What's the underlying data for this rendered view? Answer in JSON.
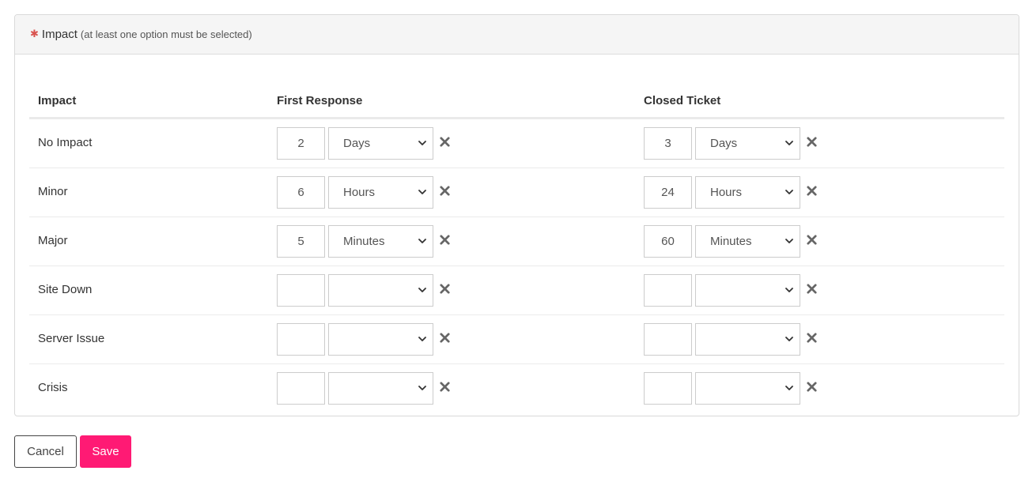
{
  "panel": {
    "required_marker": "✱",
    "title": "Impact",
    "hint": "(at least one option must be selected)"
  },
  "table": {
    "headers": {
      "impact": "Impact",
      "first_response": "First Response",
      "closed_ticket": "Closed Ticket"
    },
    "rows": [
      {
        "label": "No Impact",
        "first_response": {
          "value": "2",
          "unit": "Days"
        },
        "closed_ticket": {
          "value": "3",
          "unit": "Days"
        }
      },
      {
        "label": "Minor",
        "first_response": {
          "value": "6",
          "unit": "Hours"
        },
        "closed_ticket": {
          "value": "24",
          "unit": "Hours"
        }
      },
      {
        "label": "Major",
        "first_response": {
          "value": "5",
          "unit": "Minutes"
        },
        "closed_ticket": {
          "value": "60",
          "unit": "Minutes"
        }
      },
      {
        "label": "Site Down",
        "first_response": {
          "value": "",
          "unit": ""
        },
        "closed_ticket": {
          "value": "",
          "unit": ""
        }
      },
      {
        "label": "Server Issue",
        "first_response": {
          "value": "",
          "unit": ""
        },
        "closed_ticket": {
          "value": "",
          "unit": ""
        }
      },
      {
        "label": "Crisis",
        "first_response": {
          "value": "",
          "unit": ""
        },
        "closed_ticket": {
          "value": "",
          "unit": ""
        }
      }
    ]
  },
  "actions": {
    "cancel_label": "Cancel",
    "save_label": "Save"
  },
  "colors": {
    "accent": "#ff1a74",
    "required": "#d9534f",
    "remove_icon": "#666666"
  }
}
